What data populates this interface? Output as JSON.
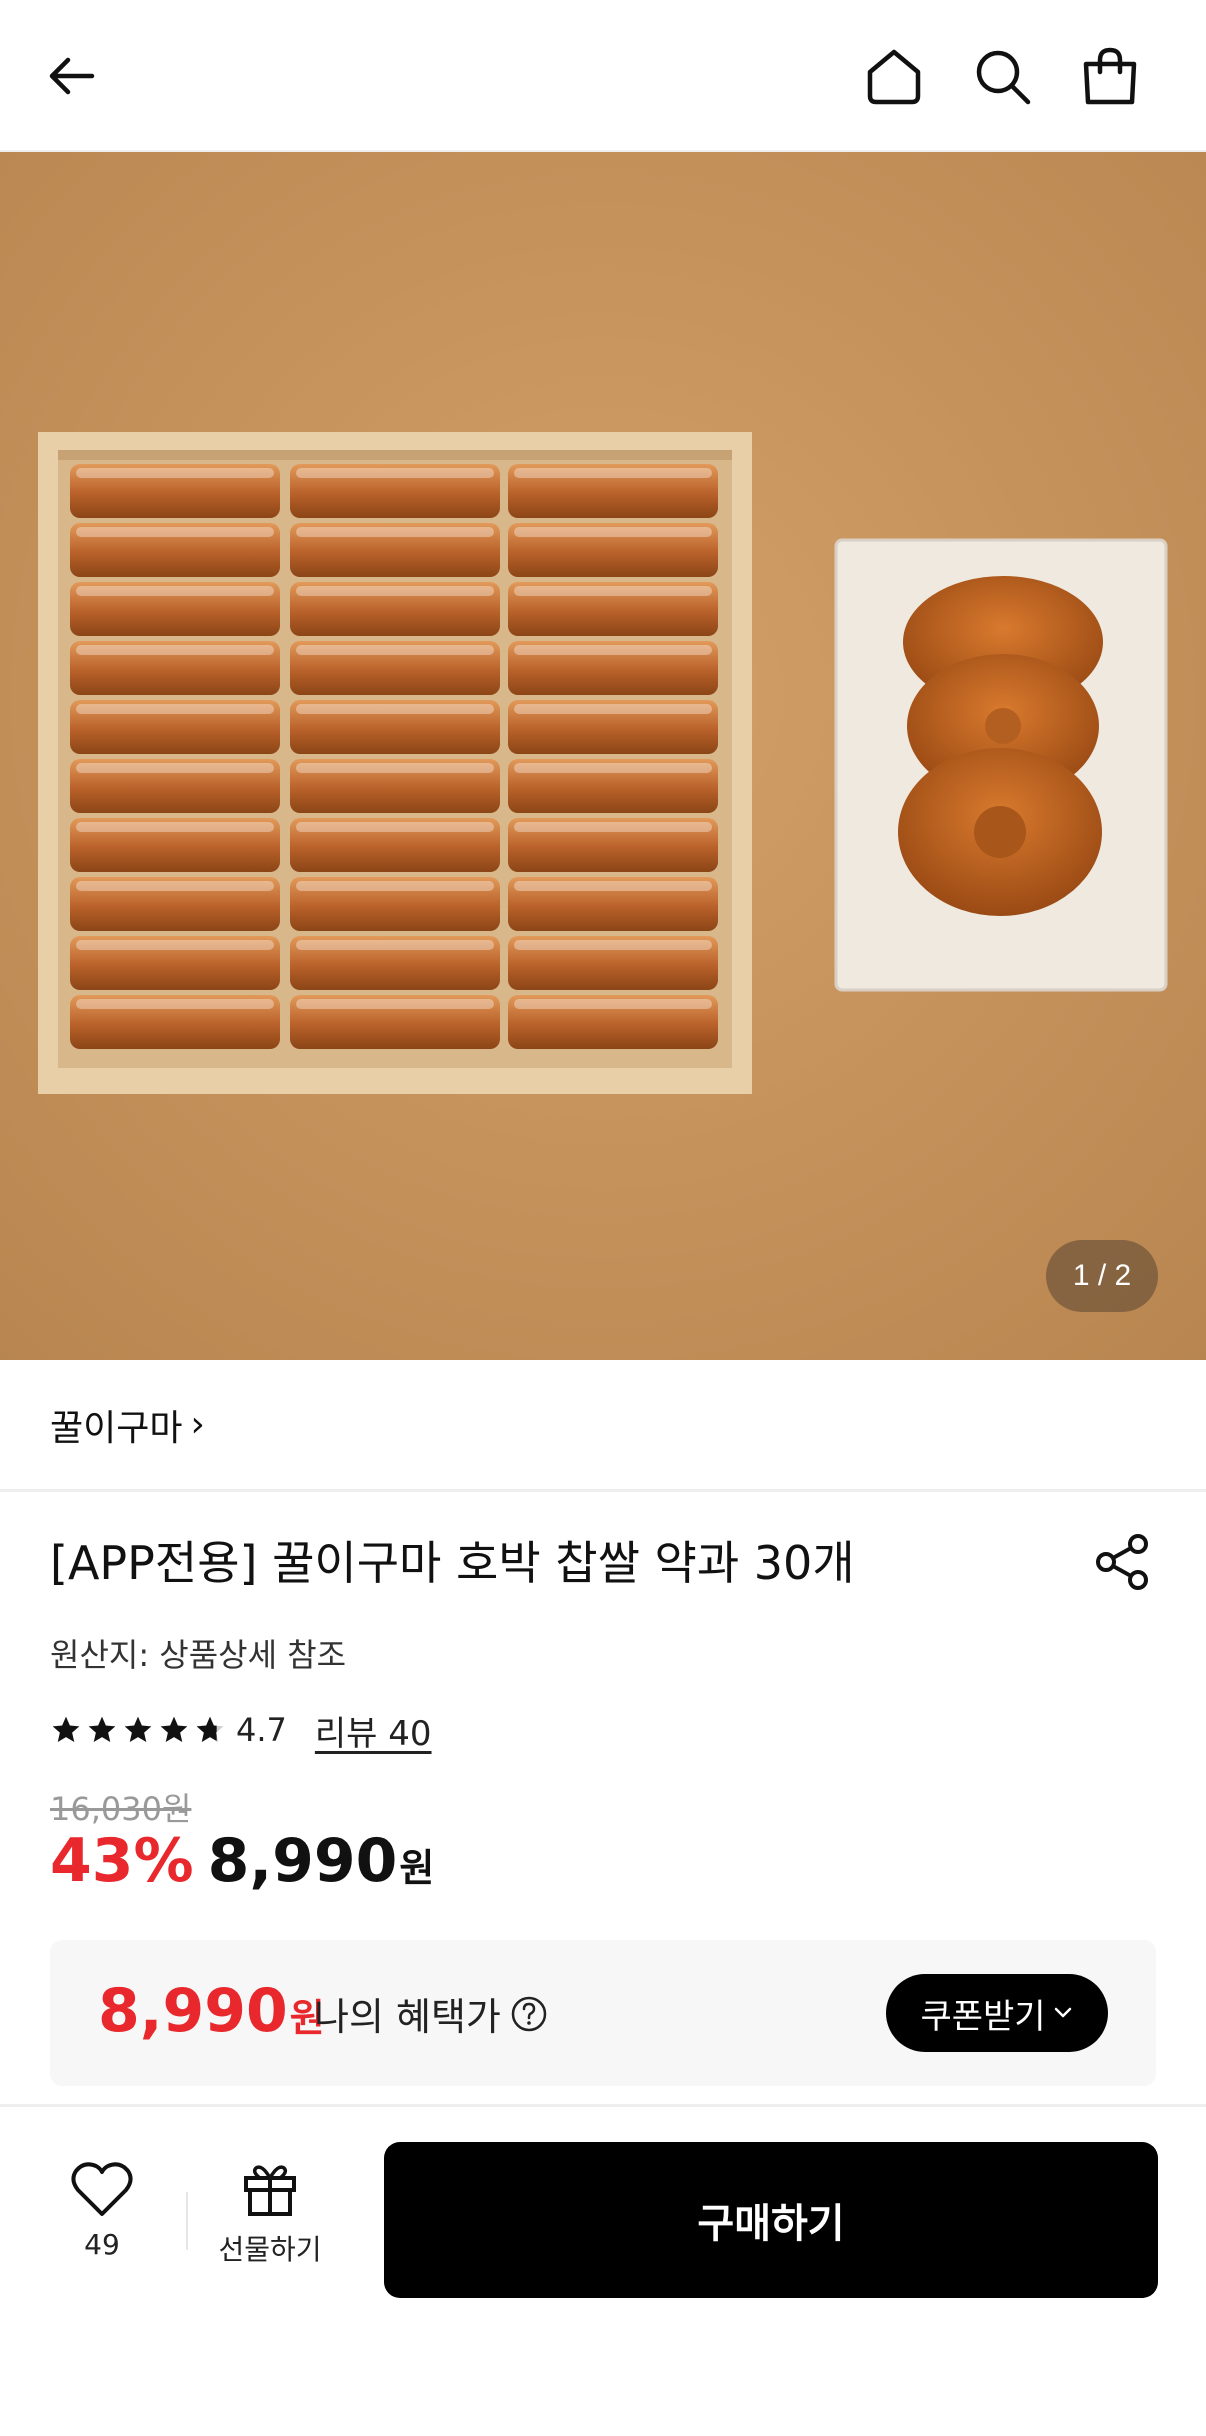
{
  "header": {
    "icons": [
      "back-arrow-icon",
      "home-icon",
      "search-icon",
      "shopping-bag-icon"
    ]
  },
  "hero": {
    "counter": "1 / 2",
    "background_color": "#c9955e"
  },
  "brand": {
    "name": "꿀이구마",
    "chevron": "›"
  },
  "product": {
    "title": "[APP전용] 꿀이구마 호박 찹쌀 약과 30개",
    "origin": "원산지: 상품상세 참조",
    "rating": "4.7",
    "rating_value": 4.7,
    "review_link": "리뷰 40",
    "original_price": "16,030원",
    "discount": "43%",
    "price": "8,990",
    "price_unit": "원"
  },
  "benefit": {
    "price": "8,990",
    "price_unit": "원",
    "label": "나의 혜택가",
    "coupon_button": "쿠폰받기",
    "coupon_chevron": "⌄"
  },
  "bottom_bar": {
    "like_count": "49",
    "gift_label": "선물하기",
    "buy_label": "구매하기"
  },
  "colors": {
    "accent_red": "#e8282c",
    "button_black": "#000000"
  }
}
